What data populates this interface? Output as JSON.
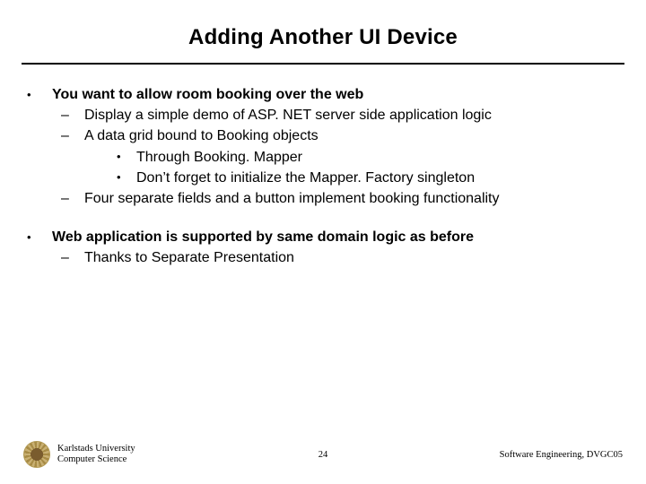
{
  "title": "Adding Another UI Device",
  "b1": {
    "head": "You want to allow room booking over the web",
    "s1": "Display a simple demo of ASP. NET server side application logic",
    "s2": "A data grid bound to Booking objects",
    "s2a": "Through Booking. Mapper",
    "s2b": "Don’t forget to initialize the Mapper. Factory singleton",
    "s3": "Four separate fields and a button implement booking functionality"
  },
  "b2": {
    "head": "Web application is supported by same domain logic as before",
    "s1": "Thanks to Separate Presentation"
  },
  "footer": {
    "inst1": "Karlstads University",
    "inst2": "Computer Science",
    "page": "24",
    "course": "Software Engineering, DVGC05"
  }
}
